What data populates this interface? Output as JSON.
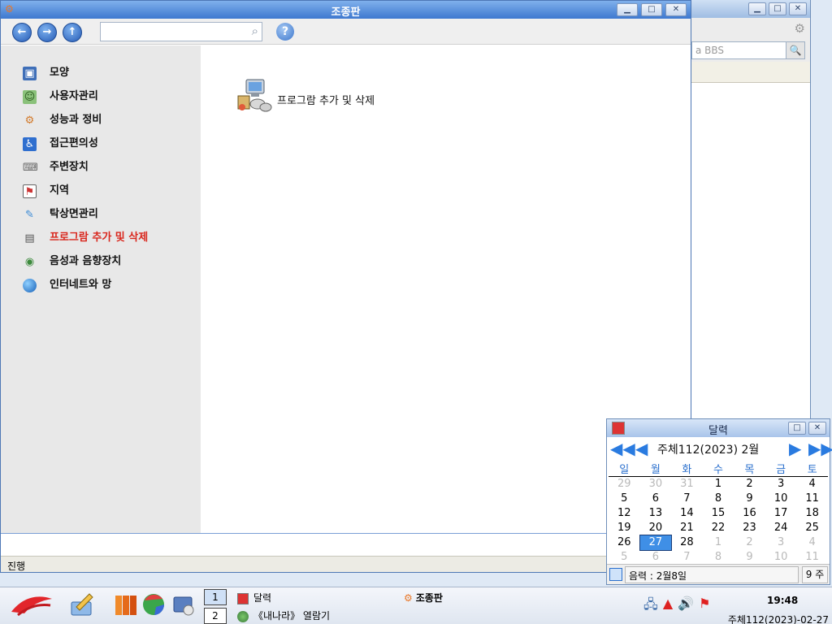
{
  "background_window": {
    "search_placeholder": "a BBS",
    "search_button_icon": "magnifier-icon"
  },
  "main_window": {
    "title": "조종판",
    "nav": {
      "back_icon": "back-arrow-icon",
      "forward_icon": "forward-arrow-icon",
      "up_icon": "up-arrow-icon",
      "address_value": "",
      "help_icon": "help-icon"
    },
    "sidebar": {
      "items": [
        {
          "label": "모양",
          "icon": "appearance-icon"
        },
        {
          "label": "사용자관리",
          "icon": "users-icon"
        },
        {
          "label": "성능과 정비",
          "icon": "performance-icon"
        },
        {
          "label": "접근편의성",
          "icon": "accessibility-icon"
        },
        {
          "label": "주변장치",
          "icon": "peripherals-icon"
        },
        {
          "label": "지역",
          "icon": "region-icon"
        },
        {
          "label": "탁상면관리",
          "icon": "desktop-icon"
        },
        {
          "label": "프로그람 추가 및 삭제",
          "icon": "add-remove-programs-icon",
          "active": true
        },
        {
          "label": "음성과 음향장치",
          "icon": "sound-icon"
        },
        {
          "label": "인터네트와 망",
          "icon": "internet-icon"
        }
      ]
    },
    "content": {
      "item_label": "프로그람 추가 및 삭제"
    },
    "status": "진행"
  },
  "calendar": {
    "title": "달력",
    "month_label": "주체112(2023)  2월",
    "weekdays": [
      "일",
      "월",
      "화",
      "수",
      "목",
      "금",
      "토"
    ],
    "weeks": [
      [
        "29",
        "30",
        "31",
        "1",
        "2",
        "3",
        "4"
      ],
      [
        "5",
        "6",
        "7",
        "8",
        "9",
        "10",
        "11"
      ],
      [
        "12",
        "13",
        "14",
        "15",
        "16",
        "17",
        "18"
      ],
      [
        "19",
        "20",
        "21",
        "22",
        "23",
        "24",
        "25"
      ],
      [
        "26",
        "27",
        "28",
        "1",
        "2",
        "3",
        "4"
      ],
      [
        "5",
        "6",
        "7",
        "8",
        "9",
        "10",
        "11"
      ]
    ],
    "today": "27",
    "lunar": "음력 : 2월8일",
    "week_number": "9 주"
  },
  "taskbar": {
    "workspace_1": "1",
    "workspace_2": "2",
    "task_1": "달력",
    "task_2": "《내나라》 열람기",
    "active_task": "조종판",
    "clock": "19:48",
    "date": "주체112(2023)-02-27"
  },
  "colors": {
    "accent": "#3d78cf",
    "active_item": "#d9261c",
    "today_bg": "#3f8fe6"
  }
}
